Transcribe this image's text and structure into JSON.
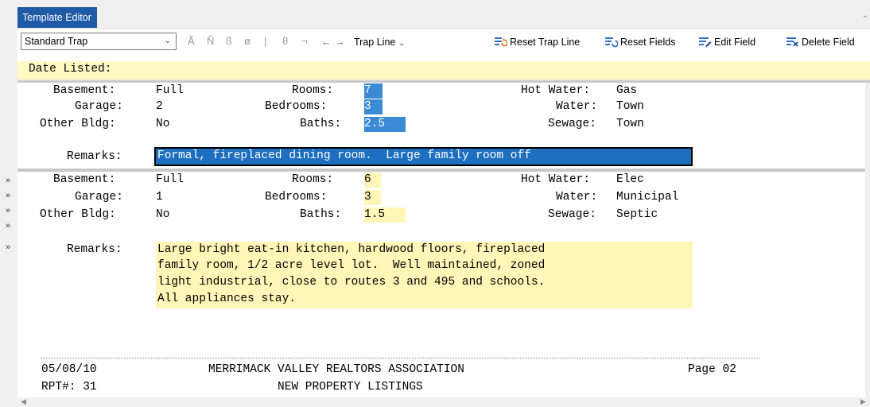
{
  "tab": {
    "title": "Template Editor",
    "menu_glyph": "⌄"
  },
  "toolbar": {
    "select_value": "Standard Trap",
    "glyphs": [
      "Ã",
      "Ñ",
      "ß",
      "ø",
      "|",
      "θ",
      "¬",
      "←",
      "→"
    ],
    "trap_line": "Trap Line",
    "reset_trap_line": "Reset Trap Line",
    "reset_fields": "Reset Fields",
    "edit_field": "Edit Field",
    "delete_field": "Delete Field"
  },
  "gutter": {
    "chevron": "»"
  },
  "date_listed": "Date Listed:",
  "record1": {
    "labels": {
      "basement": "Basement:",
      "garage": "Garage:",
      "other": "Other Bldg:",
      "rooms": "Rooms:",
      "bedrooms": "Bedrooms:",
      "baths": "Baths:",
      "hotwater": "Hot Water:",
      "water": "Water:",
      "sewage": "Sewage:",
      "remarks": "Remarks:"
    },
    "basement": "Full",
    "garage": "2",
    "other": "No",
    "rooms": "7",
    "bedrooms": "3",
    "baths": "2.5",
    "hotwater": "Gas",
    "water": "Town",
    "sewage": "Town",
    "remarks": "Formal, fireplaced dining room.  Large family room off"
  },
  "record2": {
    "labels": {
      "basement": "Basement:",
      "garage": "Garage:",
      "other": "Other Bldg:",
      "rooms": "Rooms:",
      "bedrooms": "Bedrooms:",
      "baths": "Baths:",
      "hotwater": "Hot Water:",
      "water": "Water:",
      "sewage": "Sewage:",
      "remarks": "Remarks:"
    },
    "basement": "Full",
    "garage": "1",
    "other": "No",
    "rooms": "6",
    "bedrooms": "3",
    "baths": "1.5",
    "hotwater": "Elec",
    "water": "Municipal",
    "sewage": "Septic",
    "remarks_lines": [
      "Large bright eat-in kitchen, hardwood floors, fireplaced",
      "family room, 1/2 acre level lot.  Well maintained, zoned",
      "light industrial, close to routes 3 and 495 and schools.",
      "All appliances stay."
    ]
  },
  "footer": {
    "date": "05/08/10",
    "association": "MERRIMACK VALLEY REALTORS ASSOCIATION",
    "page": "Page 02",
    "rpt": "RPT#: 31",
    "subtitle": "NEW PROPERTY LISTINGS"
  },
  "colors": {
    "tab": "#1f5aa6",
    "selection": "#3b8ad6",
    "field_highlight": "#fff6b8",
    "date_band": "#fff9c4"
  }
}
